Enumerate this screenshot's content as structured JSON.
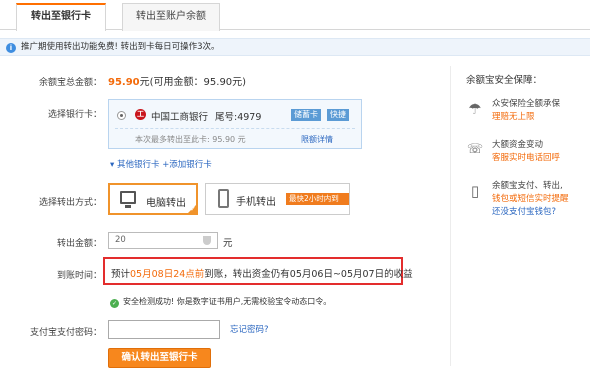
{
  "tabs": [
    {
      "label": "转出至银行卡",
      "active": true
    },
    {
      "label": "转出至账户余额",
      "active": false
    }
  ],
  "notice": {
    "text": "推广期使用转出功能免费! 转出到卡每日可操作3次。"
  },
  "total": {
    "label": "余额宝总金额：",
    "amount": "95.90",
    "unit": "元",
    "available": "(可用金额：95.90元)"
  },
  "bank": {
    "label": "选择银行卡：",
    "name": "中国工商银行",
    "tail": "尾号:4979",
    "badge1": "储蓄卡",
    "badge2": "快捷",
    "limit": "本次最多转出至此卡: 95.90 元",
    "limit_link": "限额详情",
    "other_cards": "▾ 其他银行卡",
    "add_card": "+添加银行卡"
  },
  "method": {
    "label": "选择转出方式：",
    "pc": "电脑转出",
    "mobile": "手机转出",
    "mobile_badge": "最快2小时内到账"
  },
  "amount": {
    "label": "转出金额：",
    "value": "20",
    "unit": "元"
  },
  "arrival": {
    "label": "到账时间：",
    "pre": "预计",
    "time": "05月08日24点前",
    "post": "到账，转出资金仍有05月06日~05月07日的收益"
  },
  "security": {
    "text": "安全检测成功! 你是数字证书用户,无需校验宝令动态口令。"
  },
  "password": {
    "label": "支付宝支付密码：",
    "forgot": "忘记密码?"
  },
  "confirm_button": "确认转出至银行卡",
  "right_panel": {
    "title": "余额宝安全保障：",
    "items": [
      {
        "icon": "umbrella-icon",
        "line1": "众安保险全额承保",
        "line2": "理赔无上限"
      },
      {
        "icon": "phone-24h-icon",
        "line1": "大额资金变动",
        "line2": "客服实时电话回呼"
      },
      {
        "icon": "mobile-wallet-icon",
        "line1": "余额宝支付、转出,",
        "line2": "钱包或短信实时提醒",
        "line3": "还没支付宝钱包?"
      }
    ]
  },
  "colors": {
    "accent": "#f36a0a",
    "link": "#2b67c0",
    "highlight_border": "#e32d2d",
    "button": "#f7871d"
  }
}
